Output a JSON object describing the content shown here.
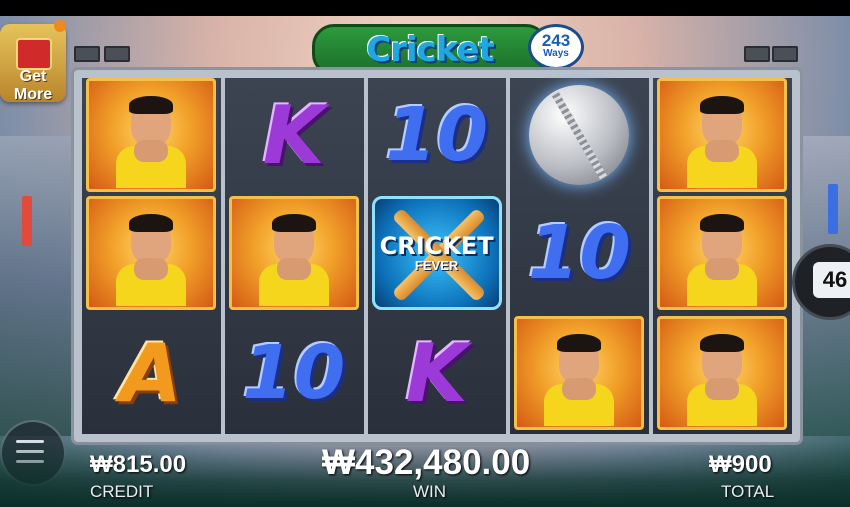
{
  "logo": {
    "title": "Cricket Fever",
    "ways_number": "243",
    "ways_label": "Ways"
  },
  "get_more": {
    "label_line1": "Get",
    "label_line2": "More"
  },
  "side_badge": {
    "value": "46"
  },
  "wild_symbol": {
    "title": "CRICKET",
    "subtitle": "FEVER"
  },
  "symbol_text": {
    "k": "K",
    "ten": "10",
    "a": "A"
  },
  "reels": [
    [
      "player",
      "player",
      "a"
    ],
    [
      "k",
      "player",
      "ten"
    ],
    [
      "ten",
      "wild",
      "k"
    ],
    [
      "ball",
      "ten",
      "player"
    ],
    [
      "player",
      "player",
      "player"
    ]
  ],
  "bottom_bar": {
    "credit_value": "₩815.00",
    "credit_label": "CREDIT",
    "win_value": "₩432,480.00",
    "win_label": "WIN",
    "total_value": "₩900",
    "total_label": "TOTAL"
  },
  "icons": [
    "gift-icon",
    "menu-icon",
    "cricket-ball-icon",
    "stadium-light-icon"
  ]
}
